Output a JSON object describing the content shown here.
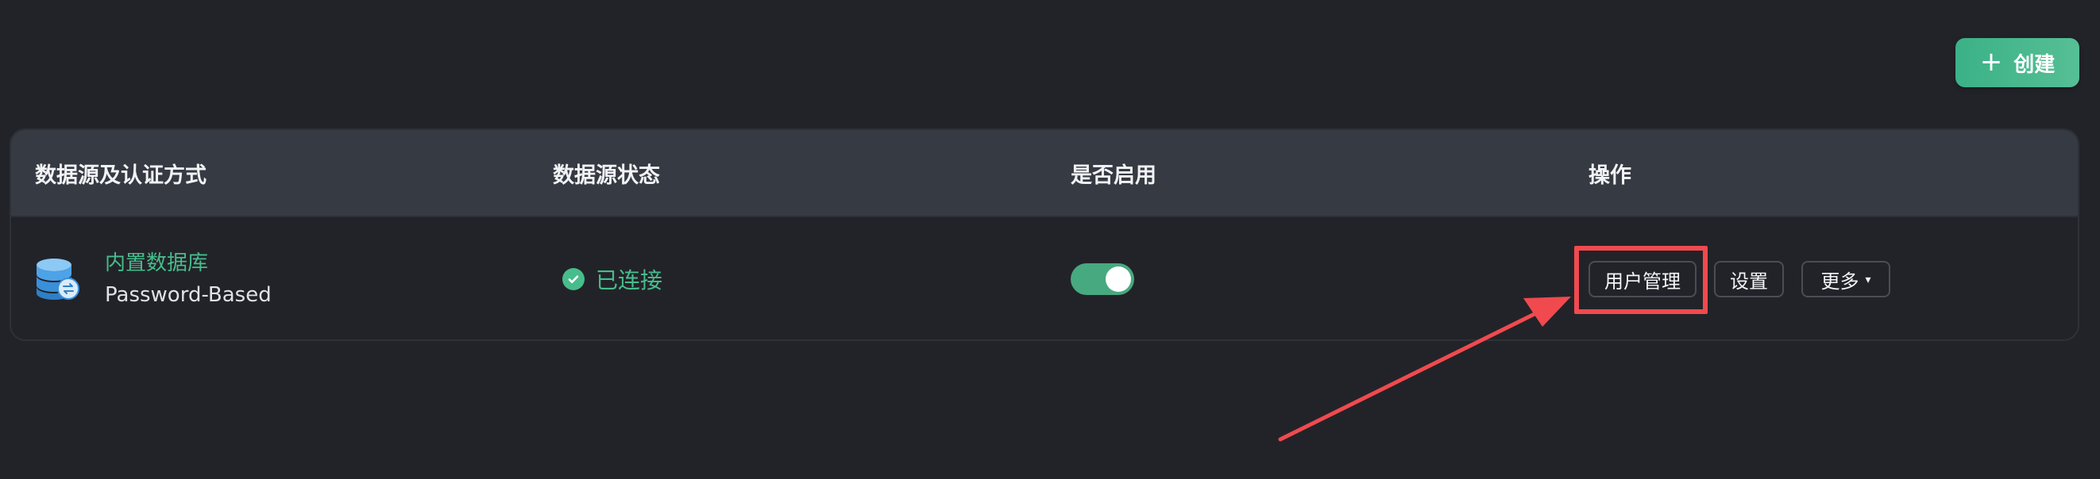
{
  "toolbar": {
    "create_label": "创建",
    "create_icon": "plus-icon"
  },
  "table": {
    "headers": [
      "数据源及认证方式",
      "数据源状态",
      "是否启用",
      "操作"
    ],
    "rows": [
      {
        "datasource_name": "内置数据库",
        "auth_method": "Password-Based",
        "icon": "database-icon",
        "status_text": "已连接",
        "status_icon": "check-circle-icon",
        "enabled": true,
        "actions": {
          "user_management": "用户管理",
          "settings": "设置",
          "more": "更多"
        }
      }
    ]
  },
  "colors": {
    "background": "#222328",
    "header_background": "#363a43",
    "accent_green": "#47bd8c",
    "annotation_red": "#f04a4f"
  }
}
